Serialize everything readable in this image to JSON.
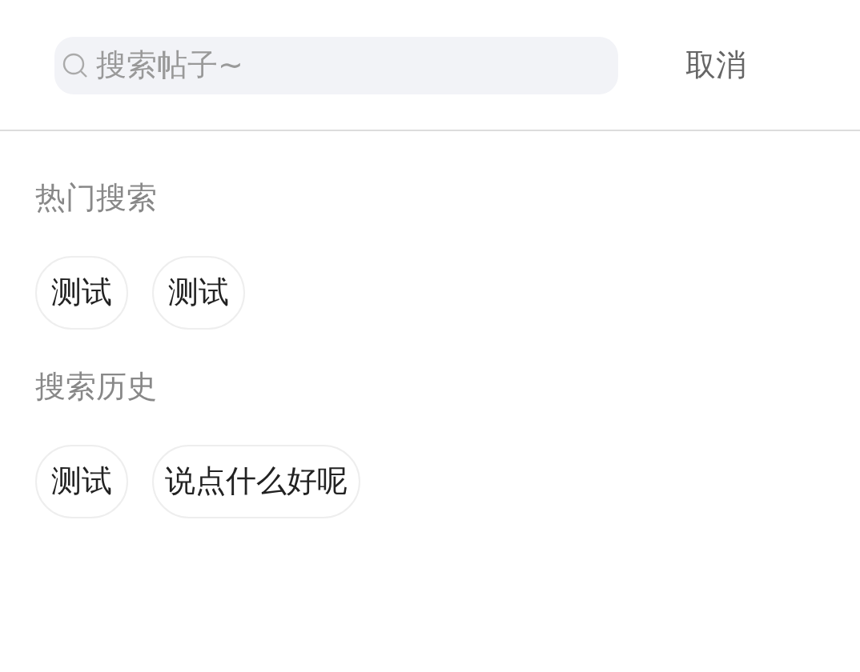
{
  "search": {
    "placeholder": "搜索帖子~",
    "cancel": "取消"
  },
  "sections": [
    {
      "title": "热门搜索",
      "tags": [
        "测试",
        "测试"
      ]
    },
    {
      "title": "搜索历史",
      "tags": [
        "测试",
        "说点什么好呢"
      ]
    }
  ]
}
